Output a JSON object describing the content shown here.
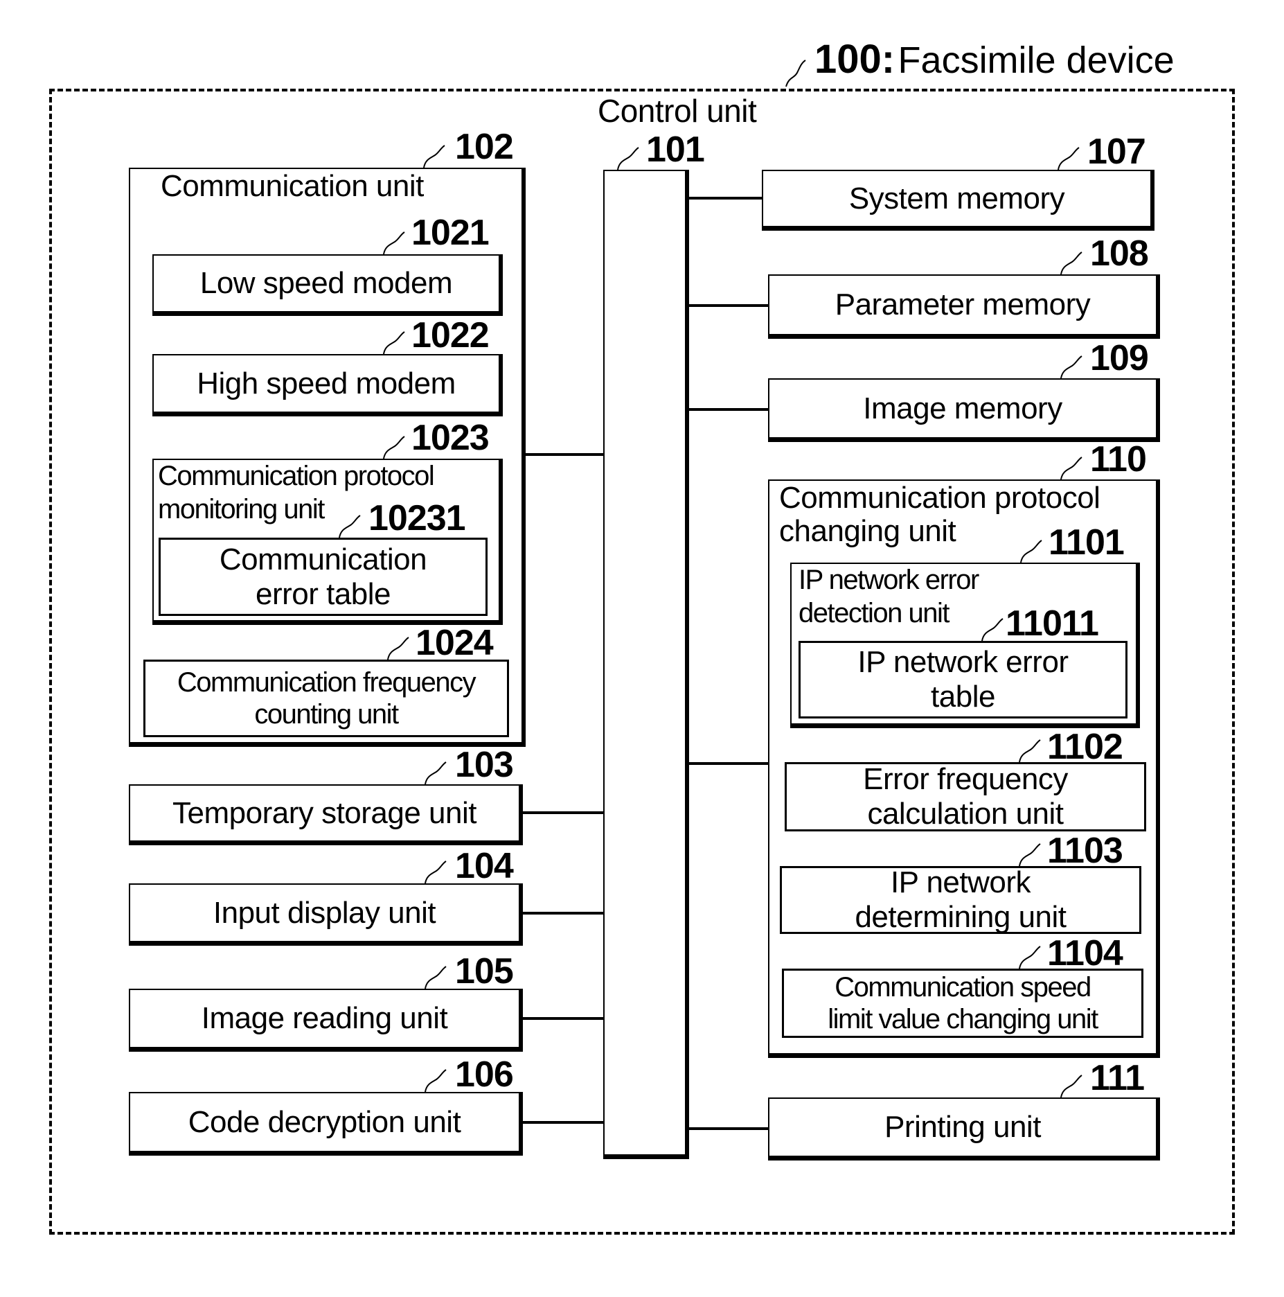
{
  "device": {
    "ref": "100:",
    "name": "Facsimile device"
  },
  "control_unit": {
    "label": "Control unit",
    "ref": "101"
  },
  "left_units": {
    "communication_unit": {
      "ref": "102",
      "label": "Communication unit",
      "low_speed_modem": {
        "ref": "1021",
        "label": "Low speed modem"
      },
      "high_speed_modem": {
        "ref": "1022",
        "label": "High speed modem"
      },
      "protocol_monitoring": {
        "ref": "1023",
        "label_line1": "Communication protocol",
        "label_line2": "monitoring unit",
        "error_table": {
          "ref": "10231",
          "line1": "Communication",
          "line2": "error table"
        }
      },
      "frequency_counting": {
        "ref": "1024",
        "line1": "Communication frequency",
        "line2": "counting unit"
      }
    },
    "temporary_storage": {
      "ref": "103",
      "label": "Temporary storage unit"
    },
    "input_display": {
      "ref": "104",
      "label": "Input display unit"
    },
    "image_reading": {
      "ref": "105",
      "label": "Image reading unit"
    },
    "code_decryption": {
      "ref": "106",
      "label": "Code decryption unit"
    }
  },
  "right_units": {
    "system_memory": {
      "ref": "107",
      "label": "System memory"
    },
    "parameter_memory": {
      "ref": "108",
      "label": "Parameter memory"
    },
    "image_memory": {
      "ref": "109",
      "label": "Image memory"
    },
    "protocol_changing": {
      "ref": "110",
      "label_line1": "Communication protocol",
      "label_line2": "changing unit",
      "ip_error_detection": {
        "ref": "1101",
        "label_line1": "IP network error",
        "label_line2": "detection unit",
        "ip_error_table": {
          "ref": "11011",
          "line1": "IP network error",
          "line2": "table"
        }
      },
      "error_frequency_calc": {
        "ref": "1102",
        "line1": "Error frequency",
        "line2": "calculation unit"
      },
      "ip_network_determining": {
        "ref": "1103",
        "line1": "IP network",
        "line2": "determining unit"
      },
      "speed_limit_changing": {
        "ref": "1104",
        "line1": "Communication speed",
        "line2": "limit value changing unit"
      }
    },
    "printing_unit": {
      "ref": "111",
      "label": "Printing unit"
    }
  }
}
